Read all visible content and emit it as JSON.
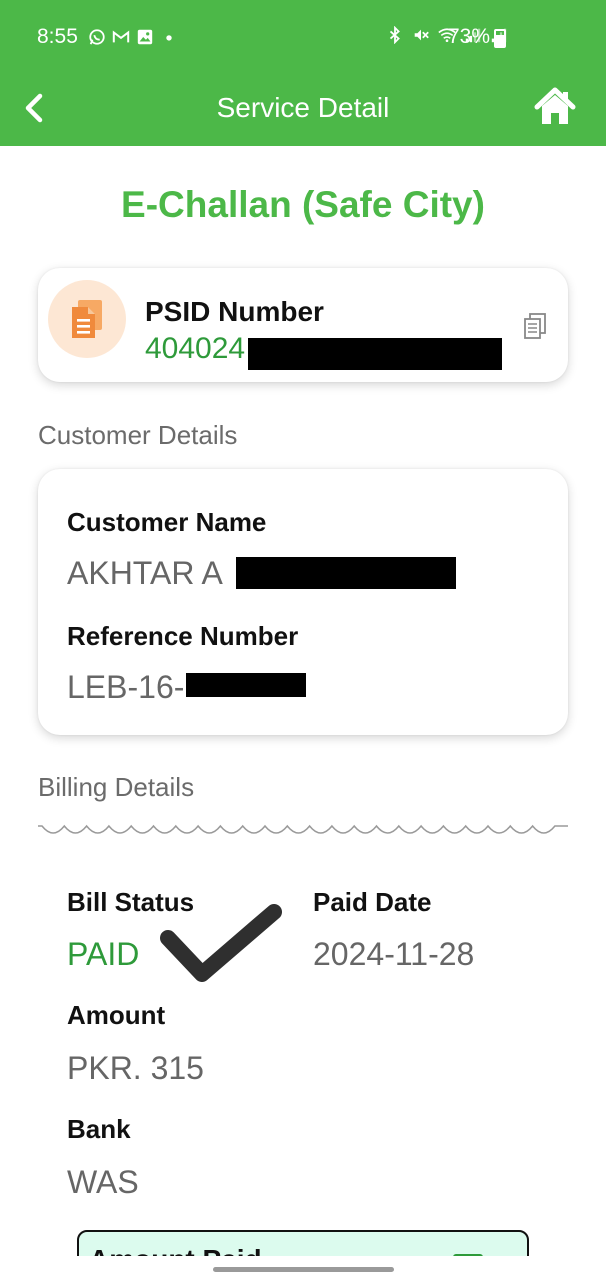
{
  "status_bar": {
    "time": "8:55",
    "battery": "73%",
    "battery_fraction": 0.73,
    "left_icons": [
      "whatsapp-icon",
      "gmail-icon",
      "gallery-icon",
      "dot-icon"
    ],
    "right_icons": [
      "bluetooth-icon",
      "mute-icon",
      "wifi-icon",
      "signal-icon",
      "signal-icon"
    ]
  },
  "header": {
    "title": "Service Detail",
    "back_icon": "chevron-left-icon",
    "home_icon": "home-icon",
    "color": "#4cb848"
  },
  "page": {
    "title": "E-Challan (Safe City)"
  },
  "psid": {
    "label": "PSID Number",
    "value": "404024",
    "icon": "document-icon",
    "copy_icon": "copy-icon"
  },
  "customer": {
    "section_label": "Customer Details",
    "name_label": "Customer Name",
    "name_value": "AKHTAR A",
    "reference_label": "Reference Number",
    "reference_value": "LEB-16-"
  },
  "billing": {
    "section_label": "Billing Details",
    "status_label": "Bill Status",
    "status_value": "PAID",
    "paid_date_label": "Paid Date",
    "paid_date_value": "2024-11-28",
    "amount_label": "Amount",
    "amount_value": "PKR. 315",
    "bank_label": "Bank",
    "bank_value": "WAS",
    "amount_paid_label": "Amount Paid"
  },
  "colors": {
    "accent": "#4cb848",
    "value_green": "#2e9a3a",
    "box_bg": "#dcfbee"
  }
}
